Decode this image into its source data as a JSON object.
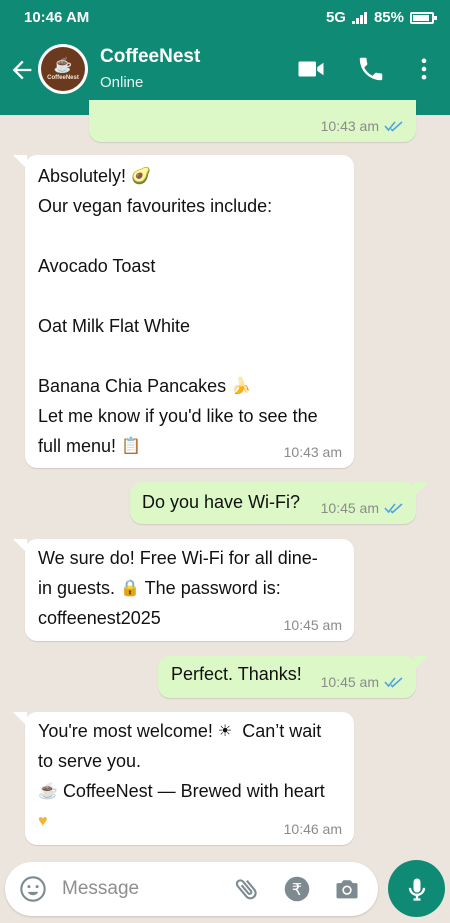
{
  "status_bar": {
    "time": "10:46 AM",
    "network": "5G",
    "battery": "85%"
  },
  "header": {
    "contact_name": "CoffeeNest",
    "contact_status": "Online",
    "avatar_label": "CoffeeNest"
  },
  "messages": [
    {
      "direction": "out",
      "text": "",
      "time": "10:43 am",
      "read": true
    },
    {
      "direction": "in",
      "lines": [
        "Absolutely!",
        "Our vegan favourites include:",
        "",
        "Avocado Toast",
        "",
        "Oat Milk Flat White",
        "",
        "Banana Chia Pancakes",
        "Let me know if you'd like to see the",
        "full menu!"
      ],
      "time": "10:43 am"
    },
    {
      "direction": "out",
      "text": "Do you have Wi-Fi?",
      "time": "10:45 am",
      "read": true
    },
    {
      "direction": "in",
      "lines": [
        "We sure do! Free Wi-Fi for all dine-",
        "in guests.",
        "The password is:",
        "coffeenest2025"
      ],
      "time": "10:45 am"
    },
    {
      "direction": "out",
      "text": "Perfect. Thanks!",
      "time": "10:45 am",
      "read": true
    },
    {
      "direction": "in",
      "lines": [
        "You're most welcome!",
        "Can’t wait",
        "to serve you.",
        "CoffeeNest — Brewed with heart"
      ],
      "time": "10:46 am"
    }
  ],
  "composer": {
    "placeholder": "Message"
  },
  "colors": {
    "header": "#0f8a74",
    "outgoing": "#dcf8c6",
    "incoming": "#ffffff",
    "tick": "#4fa3e0"
  },
  "icons": [
    "back-arrow-icon",
    "video-call-icon",
    "phone-icon",
    "more-vert-icon",
    "emoji-icon",
    "attach-icon",
    "rupee-payment-icon",
    "camera-icon",
    "mic-icon"
  ]
}
